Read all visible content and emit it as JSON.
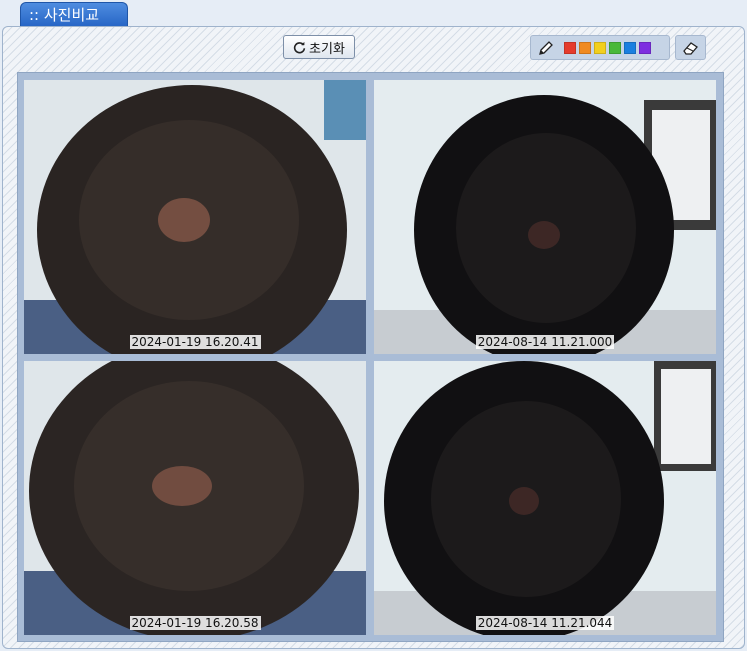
{
  "tab": {
    "label": ":: 사진비교"
  },
  "toolbar": {
    "reset_label": "초기화",
    "pen_colors": [
      "#e53b2c",
      "#f08a21",
      "#f2cf1e",
      "#49b83a",
      "#1a7fe0",
      "#7d2fe0"
    ]
  },
  "photos": [
    {
      "stamp": "2024-01-19 16.20.41"
    },
    {
      "stamp": "2024-08-14 11.21.000"
    },
    {
      "stamp": "2024-01-19 16.20.58"
    },
    {
      "stamp": "2024-08-14 11.21.044"
    }
  ]
}
